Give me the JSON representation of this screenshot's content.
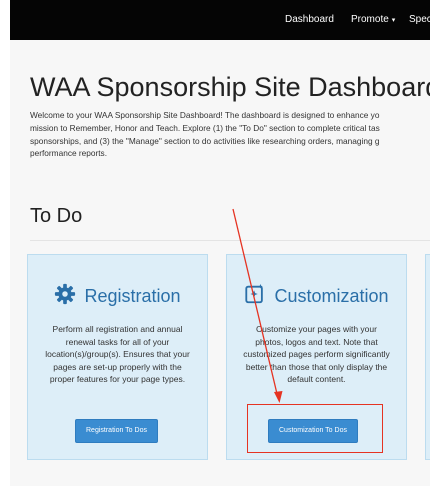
{
  "nav": {
    "items": [
      "Dashboard",
      "Promote",
      "Spec"
    ],
    "promote_caret": "▾"
  },
  "page": {
    "title": "WAA Sponsorship Site Dashboard",
    "intro_lines": [
      "Welcome to your WAA Sponsorship Site Dashboard! The dashboard is designed to enhance yo",
      "mission to Remember, Honor and Teach. Explore (1) the \"To Do\" section to complete critical tas",
      "sponsorships, and (3) the \"Manage\" section to do activities like researching orders, managing g",
      "performance reports."
    ]
  },
  "todo": {
    "title": "To Do",
    "cards": [
      {
        "title": "Registration",
        "icon": "gear-icon",
        "lines": [
          "Perform all registration and annual",
          "renewal tasks for all of your",
          "location(s)/group(s). Ensures that your",
          "pages are set-up properly with the",
          "proper features for your page types."
        ],
        "button": "Registration To Dos"
      },
      {
        "title": "Customization",
        "icon": "image-sparkle-icon",
        "lines": [
          "Customize your pages with your",
          "photos, logos and text. Note that",
          "customized pages perform significantly",
          "better than those that only display the",
          "default content."
        ],
        "button": "Customization To Dos"
      }
    ]
  },
  "colors": {
    "accent": "#2a6fa8",
    "button": "#3a8cd1",
    "annotation": "#e53322"
  }
}
